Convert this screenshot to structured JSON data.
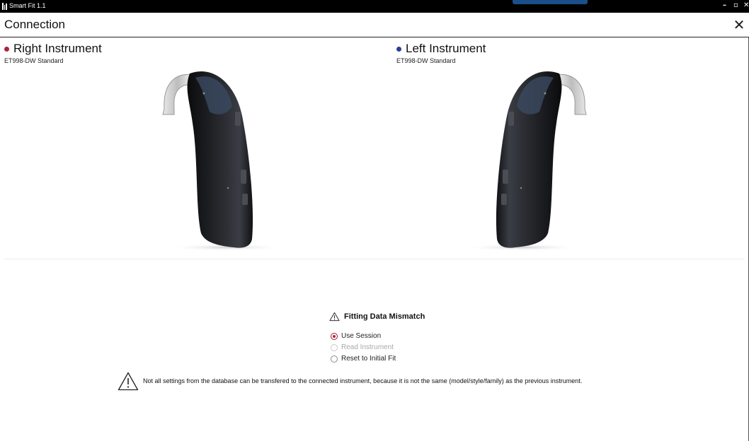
{
  "window": {
    "title": "Smart Fit 1.1",
    "minimize_glyph": "–",
    "restore_glyph": "▫",
    "close_glyph": "✕"
  },
  "header": {
    "title": "Connection",
    "close_glyph": "✕"
  },
  "instruments": {
    "right": {
      "name": "Right Instrument",
      "model": "ET998-DW  Standard",
      "color": "#b0233a"
    },
    "left": {
      "name": "Left Instrument",
      "model": "ET998-DW  Standard",
      "color": "#2a3f96"
    }
  },
  "mismatch": {
    "title": "Fitting Data Mismatch",
    "icon": "warning-triangle-icon",
    "options": [
      {
        "label": "Use Session",
        "checked": true,
        "disabled": false
      },
      {
        "label": "Read Instrument",
        "checked": false,
        "disabled": true
      },
      {
        "label": "Reset to Initial Fit",
        "checked": false,
        "disabled": false
      }
    ]
  },
  "footer": {
    "icon": "warning-triangle-icon",
    "message": "Not all settings from the database can be transfered to the connected instrument, because it is not the same (model/style/family) as the previous instrument."
  },
  "colors": {
    "titlebar": "#000000",
    "accent": "#1b4f8c",
    "selected_radio": "#b0233a"
  }
}
